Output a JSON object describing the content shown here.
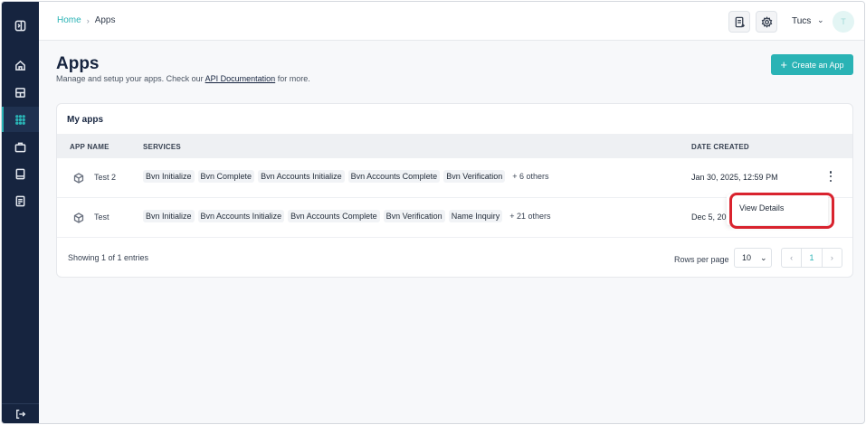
{
  "breadcrumb": {
    "home": "Home",
    "separator": "›",
    "current": "Apps"
  },
  "user": {
    "name": "Tucs",
    "chevron": "⌄",
    "avatar_initial": "T"
  },
  "page": {
    "title": "Apps",
    "subtitle_pre": "Manage and setup your apps. Check our",
    "subtitle_link": "API Documentation",
    "subtitle_post": "for more."
  },
  "create_button": {
    "icon": "+",
    "label": "Create an App"
  },
  "table": {
    "title": "My apps",
    "columns": {
      "app_name": "APP NAME",
      "services": "SERVICES",
      "date_created": "DATE CREATED"
    },
    "rows": [
      {
        "name": "Test 2",
        "services": [
          "Bvn Initialize",
          "Bvn Complete",
          "Bvn Accounts Initialize",
          "Bvn Accounts Complete",
          "Bvn Verification"
        ],
        "more": "+ 6 others",
        "date": "Jan 30, 2025, 12:59 PM"
      },
      {
        "name": "Test",
        "services": [
          "Bvn Initialize",
          "Bvn Accounts Initialize",
          "Bvn Accounts Complete",
          "Bvn Verification",
          "Name Inquiry"
        ],
        "more": "+ 21 others",
        "date": "Dec 5, 20"
      }
    ],
    "showing": "Showing 1 of 1 entries",
    "rows_per_page_label": "Rows per page",
    "rows_per_page": "10",
    "pager": {
      "prev": "‹",
      "page": "1",
      "next": "›"
    }
  },
  "context_menu": {
    "view_details": "View Details"
  },
  "sidebar": {
    "items": [
      "collapse-icon",
      "home-icon",
      "dashboard-icon",
      "apps-grid-icon",
      "briefcase-icon",
      "book-icon",
      "report-icon"
    ],
    "bottom": "logout-icon"
  },
  "colors": {
    "accent": "#2ab3b5",
    "sidebar": "#16243f",
    "highlight": "#d9232e"
  }
}
